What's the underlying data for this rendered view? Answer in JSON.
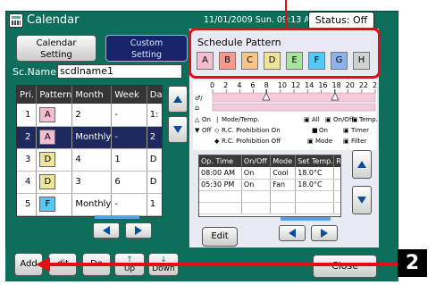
{
  "window": {
    "title": "Calendar",
    "datetime": "11/01/2009 Sun. 09:13 AM",
    "status_button": "Status: Off"
  },
  "tabs": {
    "calendar_setting": "Calendar\nSetting",
    "custom_setting": "Custom\nSetting"
  },
  "scname": {
    "label": "Sc.Name",
    "value": "scdlname1"
  },
  "pattern_list": {
    "columns": [
      "Pri.",
      "Pattern",
      "Month",
      "Week",
      "Da"
    ],
    "rows": [
      {
        "pri": "1",
        "pattern": "A",
        "month": "2",
        "week": "-",
        "day": "1:"
      },
      {
        "pri": "2",
        "pattern": "A",
        "month": "Monthly",
        "week": "-",
        "day": "2"
      },
      {
        "pri": "3",
        "pattern": "D",
        "month": "4",
        "week": "1",
        "day": "D"
      },
      {
        "pri": "4",
        "pattern": "D",
        "month": "3",
        "week": "6",
        "day": "D"
      },
      {
        "pri": "5",
        "pattern": "F",
        "month": "Monthly",
        "week": "-",
        "day": "1"
      }
    ]
  },
  "schedule_pattern": {
    "title": "Schedule Pattern",
    "buttons": [
      {
        "label": "A",
        "color": "#f6bcd0"
      },
      {
        "label": "B",
        "color": "#f59a8c"
      },
      {
        "label": "C",
        "color": "#f7c48a"
      },
      {
        "label": "D",
        "color": "#eee49a"
      },
      {
        "label": "E",
        "color": "#a8e6a0"
      },
      {
        "label": "F",
        "color": "#55c8f5"
      },
      {
        "label": "G",
        "color": "#8cb2ef"
      },
      {
        "label": "H",
        "color": "#cfd3cf"
      }
    ]
  },
  "timeline": {
    "hours": [
      "0",
      "2",
      "4",
      "6",
      "8",
      "10",
      "12",
      "14",
      "16",
      "18",
      "20",
      "22",
      "24"
    ]
  },
  "legend": {
    "on": "On",
    "off": "Off",
    "mode_temp": "Mode/Temp.",
    "rc_prohibition_on": "R.C. Prohibition On",
    "rc_prohibition_off": "R.C. Prohibition Off",
    "all": "All",
    "on_off": "On/Off",
    "temp": "Temp.",
    "on2": "On",
    "timer": "Timer",
    "mode": "Mode",
    "filter": "Filter"
  },
  "operations": {
    "columns": [
      "Op. Time",
      "On/Off",
      "Mode",
      "Set Temp.",
      "R.C."
    ],
    "rows": [
      {
        "time": "08:00 AM",
        "onoff": "On",
        "mode": "Cool",
        "temp": "18.0°C",
        "rc": ""
      },
      {
        "time": "05:30 PM",
        "onoff": "On",
        "mode": "Fan",
        "temp": "18.0°C",
        "rc": ""
      }
    ]
  },
  "buttons": {
    "add": "Add",
    "edit_partial": "dit",
    "del_partial": "De",
    "up": "Up",
    "down": "Down",
    "edit": "Edit",
    "close": "Close"
  },
  "callout": {
    "number": "2"
  }
}
